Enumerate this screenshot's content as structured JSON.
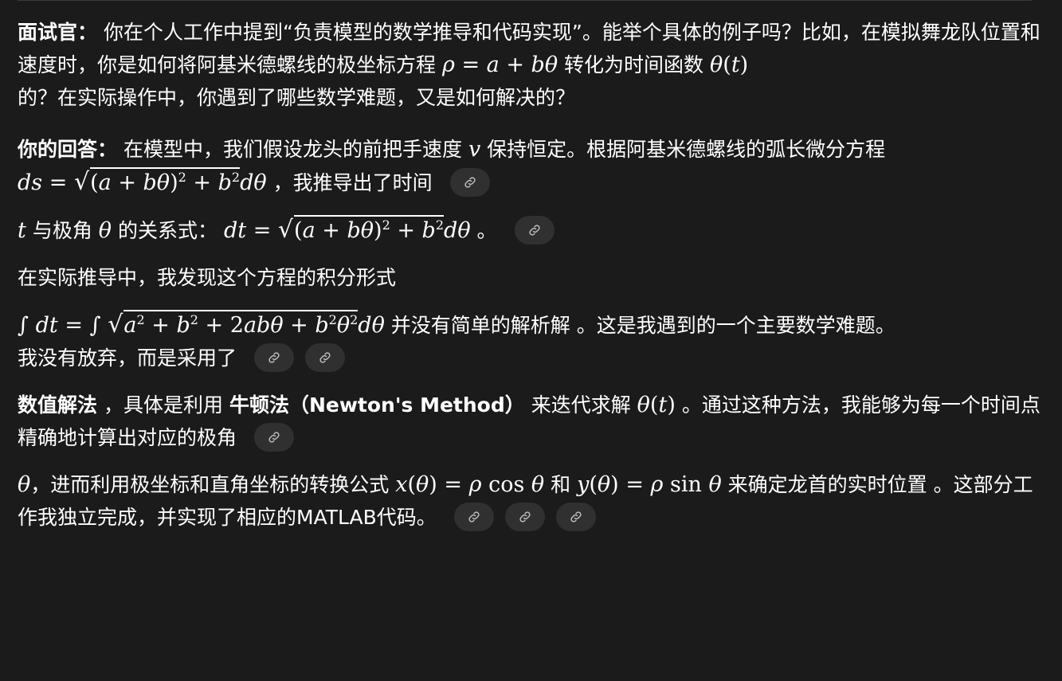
{
  "interviewer": {
    "label": "面试官：",
    "text1": "你在个人工作中提到“负责模型的数学推导和代码实现”。能举个具体的例子吗？比如，在模拟舞龙队位置和速度时，你是如何将阿基米德螺线的极坐标方程",
    "text2": "转化为时间函数",
    "text3": "的？在实际操作中，你遇到了哪些数学难题，又是如何解决的？"
  },
  "answer": {
    "label": "你的回答：",
    "p1_text1": "在模型中，我们假设龙头的前把手速度",
    "p1_text2": "保持恒定。根据阿基米德螺线的弧长微分方程",
    "p1_text3": "，我推导出了时间",
    "p2_text1": "与极角",
    "p2_text2": "的关系式：",
    "p2_text3": "。",
    "p3_text": "在实际推导中，我发现这个方程的积分形式",
    "p4_text1": "并没有简单的解析解",
    "p4_text2": "。这是我遇到的一个主要数学难题。",
    "p4_text3": "我没有放弃，而是采用了",
    "p5_bold1": "数值解法",
    "p5_text1": "，具体是利用",
    "p5_bold2": "牛顿法（Newton's Method）",
    "p5_text2": "来迭代求解",
    "p5_text3": "。通过这种方法，我能够为每一个时间点精确地计算出对应的极角",
    "p6_text1": "，进而利用极坐标和直角坐标的转换公式",
    "p6_text2": "和",
    "p6_text3": "来确定龙首的实时位置",
    "p6_text4": "。这部分工作我独立完成，并实现了相应的MATLAB代码。"
  },
  "icons": {
    "citation": "link-icon"
  }
}
